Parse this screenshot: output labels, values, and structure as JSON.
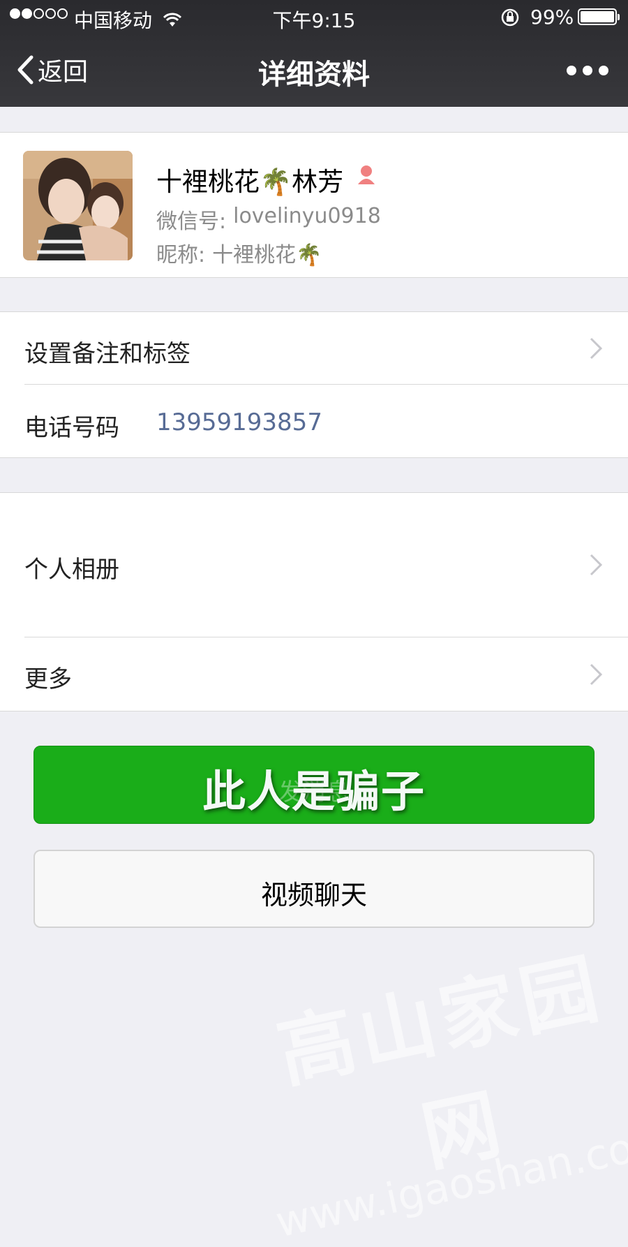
{
  "status_bar": {
    "carrier": "中国移动",
    "time": "下午9:15",
    "battery": "99%",
    "battery_level": 0.99,
    "signal_bars_filled": 2,
    "signal_bars_total": 5
  },
  "nav": {
    "back_label": "返回",
    "title": "详细资料"
  },
  "profile": {
    "name": "十裡桃花🌴林芳",
    "wechat_id_label": "微信号:",
    "wechat_id": "lovelinyu0918",
    "nickname_label": "昵称:",
    "nickname": "十裡桃花🌴"
  },
  "rows": {
    "remark_tags": "设置备注和标签",
    "phone_label": "电话号码",
    "phone": "13959193857",
    "album": "个人相册",
    "more": "更多"
  },
  "buttons": {
    "send_message_faint": "发消息",
    "overlay_text": "此人是骗子",
    "video_chat": "视频聊天"
  },
  "watermark": {
    "line1": "高山家园网",
    "line2": "www.igaoshan.com"
  },
  "colors": {
    "primary_green": "#1aad19",
    "link_blue": "#576b95",
    "nav_bg": "#2f2f33",
    "page_bg": "#efeff4"
  }
}
